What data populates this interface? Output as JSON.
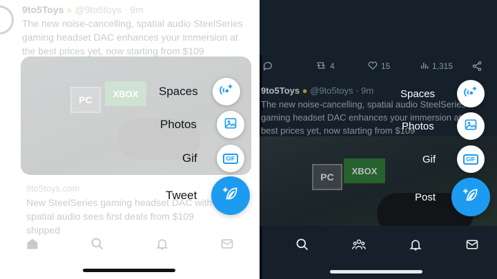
{
  "left_panel": {
    "tweet": {
      "author": "9to5Toys",
      "handle": "@9to5toys",
      "time": "9m",
      "text": "The new noise-cancelling, spatial audio SteelSeries gaming headset DAC enhances your immersion at the best prices yet, now starting from $109"
    },
    "media_labels": {
      "pc": "PC",
      "xbox": "XBOX"
    },
    "card": {
      "domain": "9to5toys.com",
      "title": "New SteelSeries gaming headset DAC with spatial audio sees first deals from $109 shipped"
    },
    "fab_menu": {
      "spaces_label": "Spaces",
      "photos_label": "Photos",
      "gif_label": "Gif",
      "primary_label": "Tweet",
      "gif_icon_text": "GIF"
    },
    "nav_icons": [
      "home-icon",
      "search-icon",
      "bell-icon",
      "mail-icon"
    ]
  },
  "right_panel": {
    "actions": {
      "retweets": "4",
      "likes": "15",
      "views": "1,315"
    },
    "tweet": {
      "author": "9to5Toys",
      "handle": "@9to5toys",
      "time": "9m",
      "text": "The new noise-cancelling, spatial audio SteelSeries gaming headset DAC enhances your immersion at the best prices yet, now starting from $109"
    },
    "media_labels": {
      "pc": "PC",
      "xbox": "XBOX"
    },
    "fab_menu": {
      "spaces_label": "Spaces",
      "photos_label": "Photos",
      "gif_label": "Gif",
      "primary_label": "Post",
      "gif_icon_text": "GIF"
    },
    "nav_icons": [
      "search-icon",
      "communities-icon",
      "bell-icon",
      "mail-icon"
    ]
  },
  "colors": {
    "accent": "#1d9bf0",
    "light_bg": "#ffffff",
    "dark_bg": "#15202b",
    "verified_gold": "#e2b719"
  }
}
